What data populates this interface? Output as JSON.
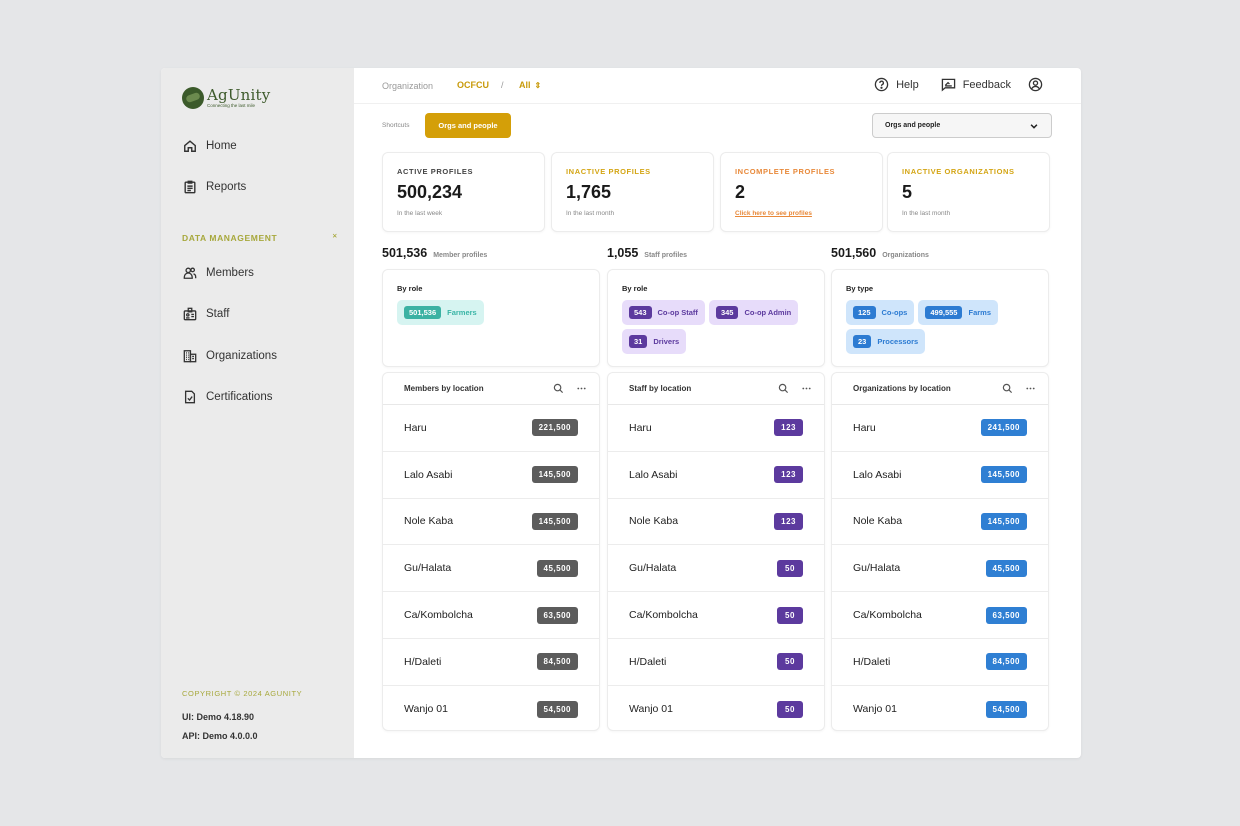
{
  "app": {
    "logo_name": "AgUnity",
    "logo_tagline": "Connecting the last mile"
  },
  "sidebar": {
    "items": [
      {
        "label": "Home",
        "icon": "home-icon"
      },
      {
        "label": "Reports",
        "icon": "clipboard-icon"
      }
    ],
    "section_label": "DATA MANAGEMENT",
    "section_toggle_icon": "collapse-icon",
    "section_items": [
      {
        "label": "Members",
        "icon": "members-icon"
      },
      {
        "label": "Staff",
        "icon": "badge-icon"
      },
      {
        "label": "Organizations",
        "icon": "building-icon"
      },
      {
        "label": "Certifications",
        "icon": "certificate-icon"
      }
    ],
    "copyright": "COPYRIGHT © 2024 AGUNITY",
    "ui_version": "UI: Demo 4.18.90",
    "api_version": "API: Demo 4.0.0.0"
  },
  "topbar": {
    "breadcrumb_label": "Organization",
    "breadcrumb_org": "OCFCU",
    "breadcrumb_sep": "/",
    "breadcrumb_scope": "All",
    "help_label": "Help",
    "feedback_label": "Feedback"
  },
  "shortcuts": {
    "label": "Shortcuts",
    "active_shortcut": "Orgs and people",
    "select_value": "Orgs and people"
  },
  "colors": {
    "accent": "#d49f08",
    "brand_green": "#3d5a2b",
    "inactive": "#d4a514",
    "incomplete": "#e8893a"
  },
  "stats": [
    {
      "title": "ACTIVE PROFILES",
      "value": "500,234",
      "sub": "In the last week",
      "color": "#444444"
    },
    {
      "title": "INACTIVE PROFILES",
      "value": "1,765",
      "sub": "In the last month",
      "color": "#d4a514"
    },
    {
      "title": "INCOMPLETE PROFILES",
      "value": "2",
      "sub": "Click here to see profiles",
      "color": "#e8893a"
    },
    {
      "title": "INACTIVE ORGANIZATIONS",
      "value": "5",
      "sub": "In the last month",
      "color": "#d4a514"
    }
  ],
  "groups": [
    {
      "total": "501,536",
      "label": "Member profiles",
      "breakdown_title": "By role",
      "chips": [
        {
          "count": "501,536",
          "label": "Farmers"
        }
      ],
      "location_title": "Members by location",
      "locations": [
        {
          "name": "Haru",
          "count": "221,500"
        },
        {
          "name": "Lalo Asabi",
          "count": "145,500"
        },
        {
          "name": "Nole Kaba",
          "count": "145,500"
        },
        {
          "name": "Gu/Halata",
          "count": "45,500"
        },
        {
          "name": "Ca/Kombolcha",
          "count": "63,500"
        },
        {
          "name": "H/Daleti",
          "count": "84,500"
        },
        {
          "name": "Wanjo 01",
          "count": "54,500"
        }
      ]
    },
    {
      "total": "1,055",
      "label": "Staff profiles",
      "breakdown_title": "By role",
      "chips": [
        {
          "count": "543",
          "label": "Co-op Staff"
        },
        {
          "count": "345",
          "label": "Co-op Admin"
        },
        {
          "count": "31",
          "label": "Drivers"
        }
      ],
      "location_title": "Staff by location",
      "locations": [
        {
          "name": "Haru",
          "count": "123"
        },
        {
          "name": "Lalo Asabi",
          "count": "123"
        },
        {
          "name": "Nole Kaba",
          "count": "123"
        },
        {
          "name": "Gu/Halata",
          "count": "50"
        },
        {
          "name": "Ca/Kombolcha",
          "count": "50"
        },
        {
          "name": "H/Daleti",
          "count": "50"
        },
        {
          "name": "Wanjo 01",
          "count": "50"
        }
      ]
    },
    {
      "total": "501,560",
      "label": "Organizations",
      "breakdown_title": "By type",
      "chips": [
        {
          "count": "125",
          "label": "Co-ops"
        },
        {
          "count": "499,555",
          "label": "Farms"
        },
        {
          "count": "23",
          "label": "Processors"
        }
      ],
      "location_title": "Organizations by location",
      "locations": [
        {
          "name": "Haru",
          "count": "241,500"
        },
        {
          "name": "Lalo Asabi",
          "count": "145,500"
        },
        {
          "name": "Nole Kaba",
          "count": "145,500"
        },
        {
          "name": "Gu/Halata",
          "count": "45,500"
        },
        {
          "name": "Ca/Kombolcha",
          "count": "63,500"
        },
        {
          "name": "H/Daleti",
          "count": "84,500"
        },
        {
          "name": "Wanjo 01",
          "count": "54,500"
        }
      ]
    }
  ]
}
